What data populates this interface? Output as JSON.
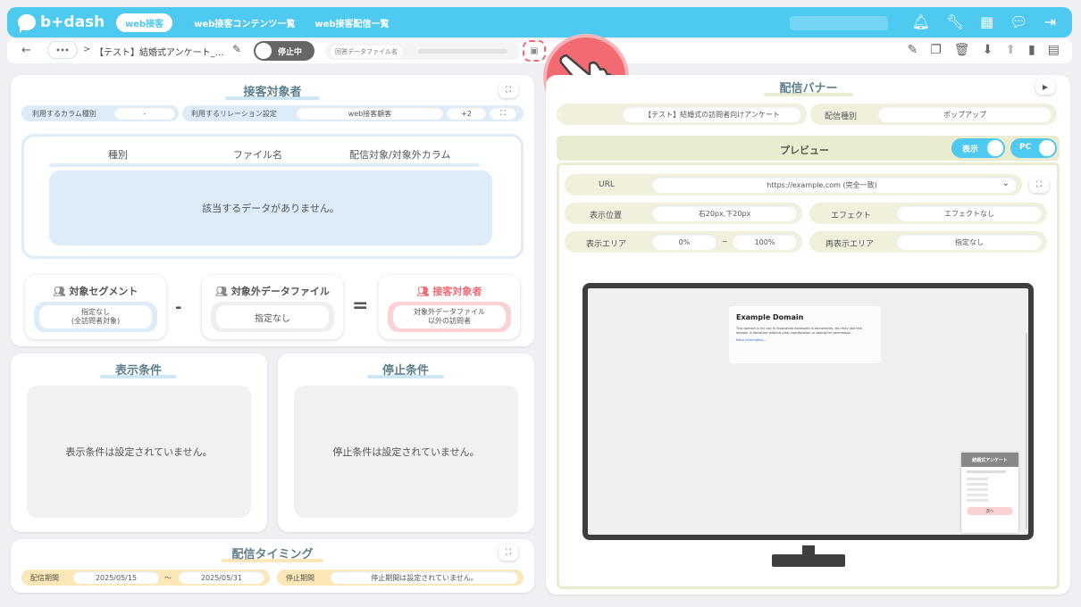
{
  "topbar": {
    "logo": "b+dash",
    "nav_active": "web接客",
    "nav_links": [
      "web接客コンテンツ一覧",
      "web接客配信一覧"
    ]
  },
  "toolbar": {
    "more": "•••",
    "crumb_sep": ">",
    "title": "【テスト】結婚式アンケート_…",
    "status": "停止中",
    "answer_file_label": "回答データファイル名"
  },
  "target": {
    "title": "接客対象者",
    "column_type_label": "利用するカラム種別",
    "column_type_value": "-",
    "relation_label": "利用するリレーション設定",
    "relation_value": "web接客顧客",
    "relation_more": "+2",
    "table_headers": [
      "種別",
      "ファイル名",
      "配信対象/対象外カラム"
    ],
    "empty_text": "該当するデータがありません。",
    "segment_title": "対象セグメント",
    "segment_value": "指定なし\n(全訪問者対象)",
    "minus": "-",
    "excluded_title": "対象外データファイル",
    "excluded_value": "指定なし",
    "equals": "=",
    "result_title": "接客対象者",
    "result_value": "対象外データファイル\n以外の訪問者"
  },
  "conditions": {
    "display_title": "表示条件",
    "display_empty": "表示条件は設定されていません。",
    "stop_title": "停止条件",
    "stop_empty": "停止条件は設定されていません。"
  },
  "timing": {
    "title": "配信タイミング",
    "period_label": "配信期間",
    "start": "2025/05/15",
    "tilde": "～",
    "end": "2025/05/31",
    "stop_label": "停止期間",
    "stop_value": "停止期間は設定されていません。"
  },
  "banner": {
    "title": "配信バナー",
    "name_value": "【テスト】結婚式の訪問者向けアンケート",
    "type_label": "配信種別",
    "type_value": "ポップアップ",
    "preview_label": "プレビュー",
    "show_toggle": "表示",
    "pc_toggle": "PC",
    "url_label": "URL",
    "url_value": "https://example.com (完全一致)",
    "position_label": "表示位置",
    "position_value": "右20px,下20px",
    "effect_label": "エフェクト",
    "effect_value": "エフェクトなし",
    "area_label": "表示エリア",
    "area_from": "0%",
    "area_tilde": "~",
    "area_to": "100%",
    "redisplay_label": "再表示エリア",
    "redisplay_value": "指定なし"
  },
  "preview": {
    "site_title": "Example Domain",
    "site_body": "This domain is for use in illustrative examples in documents. You may use this domain in literature without prior coordination or asking for permission.",
    "site_link": "More information...",
    "popup_header": "結婚式アンケート",
    "popup_next": "次へ"
  },
  "colors": {
    "accent": "#4ec9f0",
    "cream": "#f1f0dd",
    "blue_soft": "#dcecf8",
    "pink": "#f26b73",
    "yellow": "#fbe7b7"
  }
}
